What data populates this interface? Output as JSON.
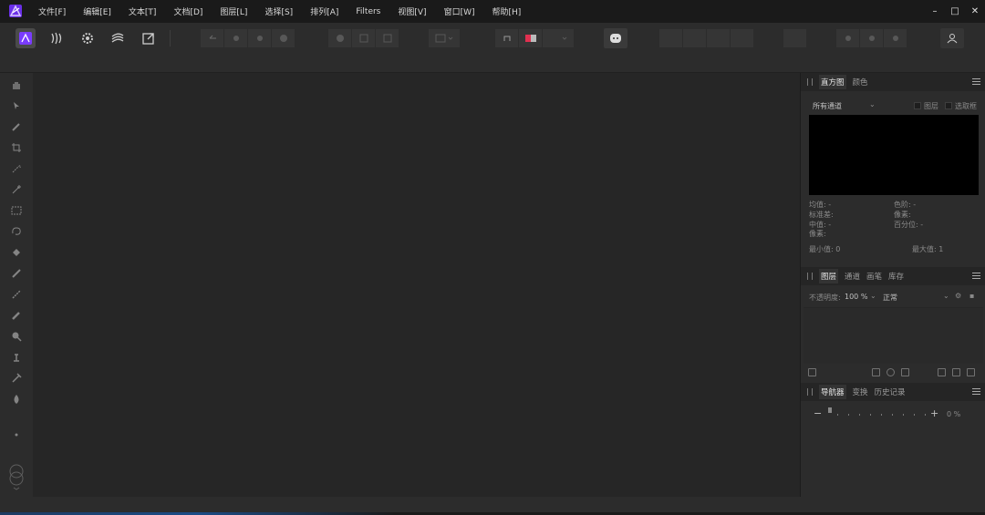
{
  "menu": {
    "items": [
      "文件[F]",
      "编辑[E]",
      "文本[T]",
      "文档[D]",
      "图层[L]",
      "选择[S]",
      "排列[A]",
      "Filters",
      "视图[V]",
      "窗口[W]",
      "帮助[H]"
    ]
  },
  "window_controls": {
    "minimize": "–",
    "maximize": "□",
    "close": "✕"
  },
  "colors": {
    "accent": "#7a3cff",
    "canvas": "#262626",
    "panel": "#2c2c2c",
    "histogram_bg": "#000000"
  },
  "histogram_panel": {
    "tabs": [
      "直方图",
      "颜色"
    ],
    "channel_select": "所有通道",
    "checkbox_layer": "图层",
    "checkbox_marquee": "选取框",
    "stats": {
      "mean": "均值: -",
      "std_dev": "标准差:",
      "median": "中值: -",
      "pixels_left": "像素:",
      "level": "色阶: -",
      "pixels_right": "像素:",
      "percentile": "百分位: -",
      "min": "最小值: 0",
      "max": "最大值: 1"
    }
  },
  "layers_panel": {
    "tabs": [
      "图层",
      "通道",
      "画笔",
      "库存"
    ],
    "opacity_label": "不透明度:",
    "opacity_value": "100 %",
    "blend_mode": "正常"
  },
  "navigator_panel": {
    "tabs": [
      "导航器",
      "变换",
      "历史记录"
    ],
    "zoom_minus": "−",
    "zoom_plus": "+",
    "zoom_value": "0 %"
  }
}
